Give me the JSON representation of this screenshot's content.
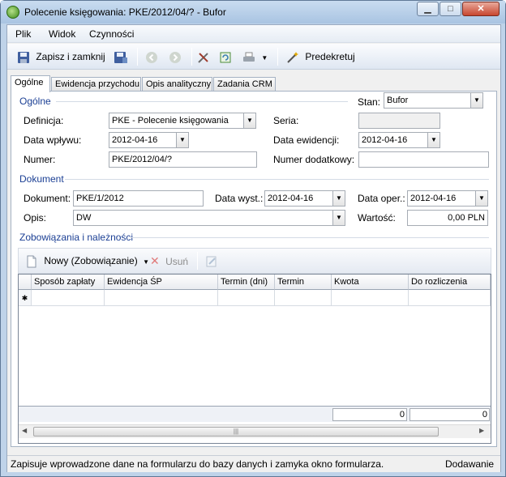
{
  "window": {
    "title": "Polecenie księgowania: PKE/2012/04/? - Bufor",
    "min_glyph": "▁",
    "max_glyph": "□",
    "close_glyph": "✕"
  },
  "menu": {
    "items": [
      {
        "label": "Plik"
      },
      {
        "label": "Widok"
      },
      {
        "label": "Czynności"
      }
    ]
  },
  "toolbar": {
    "save_close_label": "Zapisz i zamknij",
    "predekretuj_label": "Predekretuj"
  },
  "tabs": [
    {
      "label": "Ogólne",
      "active": true
    },
    {
      "label": "Ewidencja przychodu"
    },
    {
      "label": "Opis analityczny"
    },
    {
      "label": "Zadania CRM"
    }
  ],
  "general": {
    "group_title": "Ogólne",
    "stan_label": "Stan:",
    "stan_value": "Bufor",
    "definicja_label": "Definicja:",
    "definicja_value": "PKE - Polecenie księgowania",
    "seria_label": "Seria:",
    "seria_value": "",
    "data_wplywu_label": "Data wpływu:",
    "data_wplywu_value": "2012-04-16",
    "data_ewidencji_label": "Data ewidencji:",
    "data_ewidencji_value": "2012-04-16",
    "numer_label": "Numer:",
    "numer_value": "PKE/2012/04/?",
    "numer_dodatkowy_label": "Numer dodatkowy:",
    "numer_dodatkowy_value": ""
  },
  "document": {
    "group_title": "Dokument",
    "dokument_label": "Dokument:",
    "dokument_value": "PKE/1/2012",
    "data_wyst_label": "Data wyst.:",
    "data_wyst_value": "2012-04-16",
    "data_oper_label": "Data oper.:",
    "data_oper_value": "2012-04-16",
    "opis_label": "Opis:",
    "opis_value": "DW",
    "wartosc_label": "Wartość:",
    "wartosc_value": "0,00 PLN"
  },
  "liabilities": {
    "group_title": "Zobowiązania i należności",
    "new_label": "Nowy (Zobowiązanie)",
    "delete_label": "Usuń",
    "columns": [
      "Sposób zapłaty",
      "Ewidencja ŚP",
      "Termin (dni)",
      "Termin",
      "Kwota",
      "Do rozliczenia"
    ],
    "new_row_marker": "✱",
    "sum_kwota": "0",
    "sum_do_rozliczenia": "0"
  },
  "status": {
    "message": "Zapisuje wprowadzone dane na formularzu do bazy danych i zamyka okno formularza.",
    "mode": "Dodawanie"
  },
  "colors": {
    "group_title": "#1b3f94",
    "title_bar": "#bfd3e9"
  }
}
